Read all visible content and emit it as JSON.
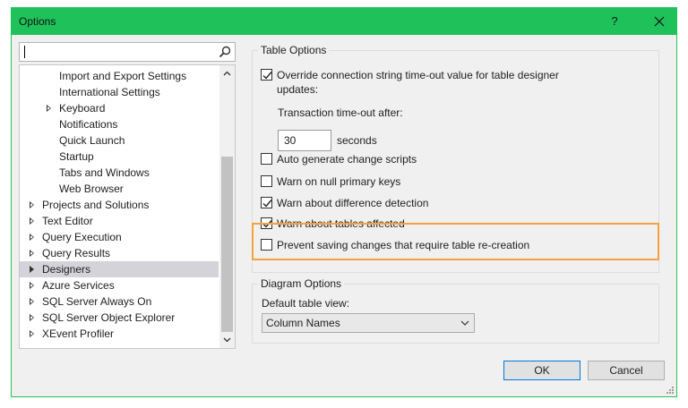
{
  "window": {
    "title": "Options",
    "help_label": "?"
  },
  "search": {
    "value": "",
    "placeholder": ""
  },
  "tree": {
    "items": [
      {
        "label": "Import and Export Settings"
      },
      {
        "label": "International Settings"
      },
      {
        "label": "Keyboard"
      },
      {
        "label": "Notifications"
      },
      {
        "label": "Quick Launch"
      },
      {
        "label": "Startup"
      },
      {
        "label": "Tabs and Windows"
      },
      {
        "label": "Web Browser"
      },
      {
        "label": "Projects and Solutions"
      },
      {
        "label": "Text Editor"
      },
      {
        "label": "Query Execution"
      },
      {
        "label": "Query Results"
      },
      {
        "label": "Designers"
      },
      {
        "label": "Azure Services"
      },
      {
        "label": "SQL Server Always On"
      },
      {
        "label": "SQL Server Object Explorer"
      },
      {
        "label": "XEvent Profiler"
      }
    ]
  },
  "table_options": {
    "title": "Table Options",
    "override_line1": "Override connection string time-out value for table designer",
    "override_line2": "updates:",
    "timeout_label": "Transaction time-out after:",
    "timeout_value": "30",
    "timeout_unit": "seconds",
    "checks": [
      {
        "label": "Auto generate change scripts",
        "checked": false
      },
      {
        "label": "Warn on null primary keys",
        "checked": false
      },
      {
        "label": "Warn about difference detection",
        "checked": true
      },
      {
        "label": "Warn about tables affected",
        "checked": true
      },
      {
        "label": "Prevent saving changes that require table re-creation",
        "checked": false
      }
    ]
  },
  "diagram_options": {
    "title": "Diagram Options",
    "default_view_label": "Default table view:",
    "default_view_value": "Column Names"
  },
  "buttons": {
    "ok": "OK",
    "cancel": "Cancel"
  },
  "colors": {
    "titlebar": "#1fc25a",
    "highlight": "#f4a23d",
    "selection": "#d3d3d9",
    "focus": "#0078d7"
  }
}
